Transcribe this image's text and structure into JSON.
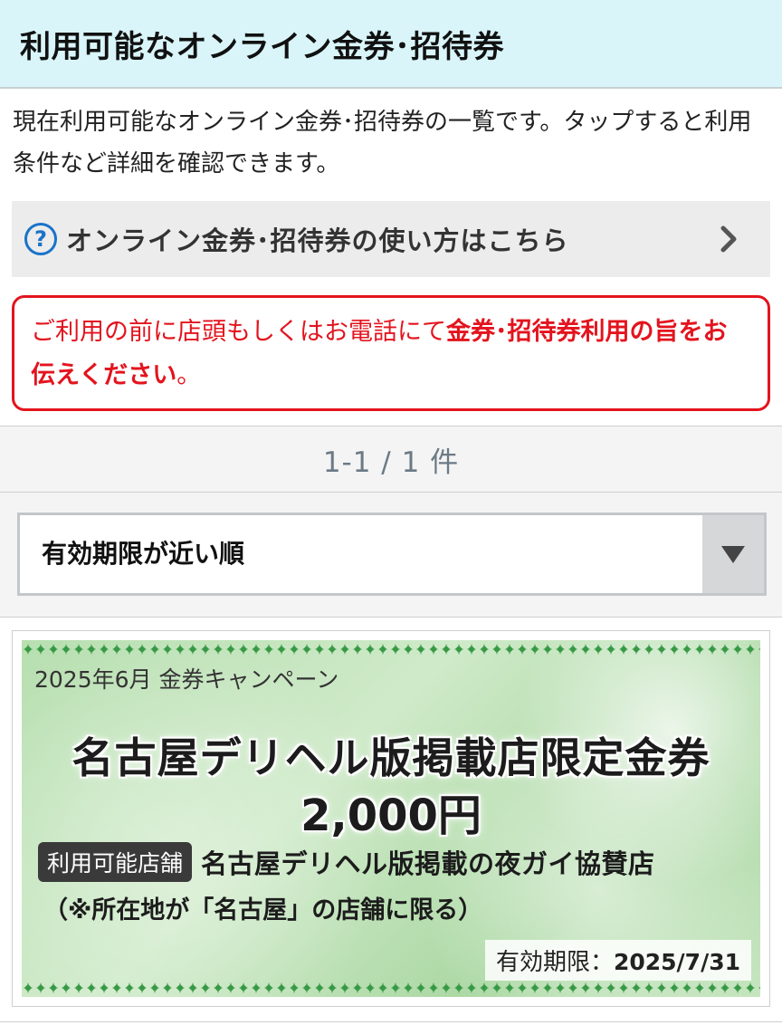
{
  "header": {
    "title": "利用可能なオンライン金券･招待券"
  },
  "intro": {
    "text": "現在利用可能なオンライン金券･招待券の一覧です。タップすると利用条件など詳細を確認できます。"
  },
  "howto": {
    "icon": "question-circle-icon",
    "label": "オンライン金券･招待券の使い方はこちら",
    "accent": "#1a73c9"
  },
  "notice": {
    "text_normal": "ご利用の前に店頭もしくはお電話にて",
    "text_bold": "金券･招待券利用の旨をお伝えください",
    "text_end": "。",
    "color": "#e3141e"
  },
  "pagination": {
    "count_text": "1-1 / 1 件"
  },
  "sort": {
    "selected": "有効期限が近い順"
  },
  "coupons": [
    {
      "campaign": "2025年6月 金券キャンペーン",
      "title_line1": "名古屋デリヘル版掲載店限定金券",
      "title_line2": "2,000円",
      "store_badge": "利用可能店舗",
      "store_name": "名古屋デリヘル版掲載の夜ガイ協賛店",
      "store_note": "（※所在地が「名古屋」の店舗に限る）",
      "expiry_label": "有効期限：",
      "expiry_date": "2025/7/31"
    }
  ]
}
